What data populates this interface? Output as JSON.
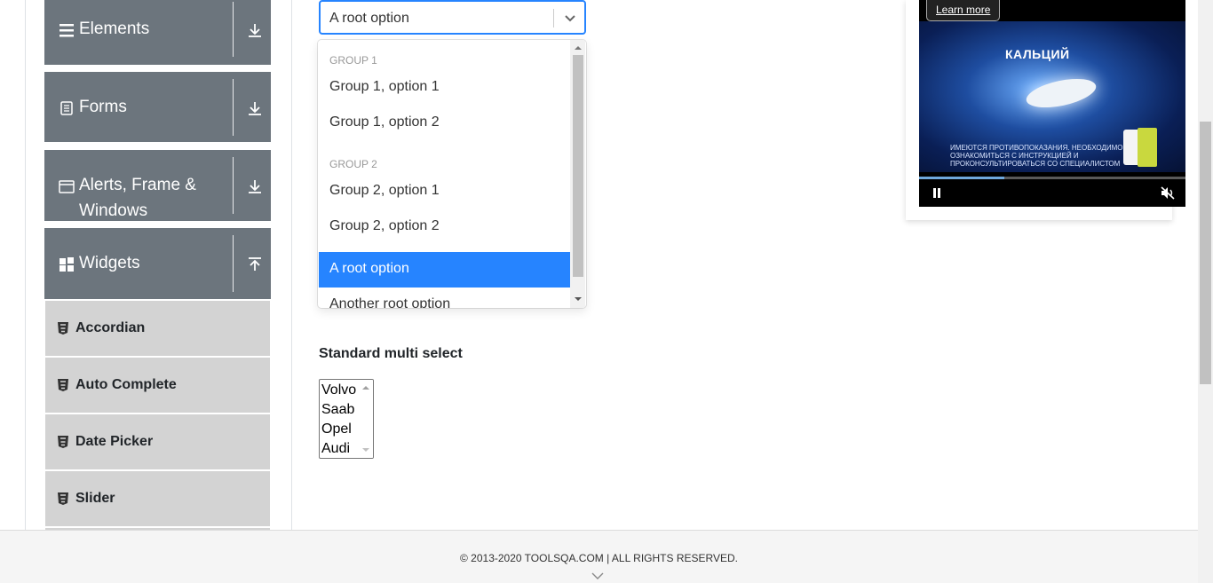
{
  "sidebar": {
    "groups": [
      {
        "label": "Elements",
        "icon": "menu-lines-icon",
        "toggle_icon": "download-arrow-icon"
      },
      {
        "label": "Forms",
        "icon": "document-icon",
        "toggle_icon": "download-arrow-icon"
      },
      {
        "label_line1": "Alerts, Frame &",
        "label_line2": "Windows",
        "icon": "browser-window-icon",
        "toggle_icon": "download-arrow-icon"
      },
      {
        "label": "Widgets",
        "icon": "grid-blocks-icon",
        "toggle_icon": "upload-arrow-icon"
      }
    ],
    "widget_items": [
      "Accordian",
      "Auto Complete",
      "Date Picker",
      "Slider"
    ],
    "colors": {
      "header_bg": "#6c757d",
      "item_bg": "#d3d3d3"
    }
  },
  "select": {
    "value": "A root option",
    "groups": [
      {
        "heading": "Group 1",
        "options": [
          "Group 1, option 1",
          "Group 1, option 2"
        ]
      },
      {
        "heading": "Group 2",
        "options": [
          "Group 2, option 1",
          "Group 2, option 2"
        ]
      }
    ],
    "root_options": [
      "A root option",
      "Another root option"
    ],
    "selected": "A root option",
    "accent": "#2684ff"
  },
  "multi_select": {
    "label": "Standard multi select",
    "options": [
      "Volvo",
      "Saab",
      "Opel",
      "Audi"
    ]
  },
  "ad": {
    "learn_more": "Learn more",
    "brand": "КАЛЬЦИЙ",
    "disclaimer": "ИМЕЮТСЯ ПРОТИВОПОКАЗАНИЯ. НЕОБХОДИМО ОЗНАКОМИТЬСЯ С ИНСТРУКЦИЕЙ И ПРОКОНСУЛЬТИРОВАТЬСЯ СО СПЕЦИАЛИСТОМ",
    "progress": 0.32
  },
  "footer": {
    "copyright": "© 2013-2020 TOOLSQA.COM | ALL RIGHTS RESERVED."
  }
}
